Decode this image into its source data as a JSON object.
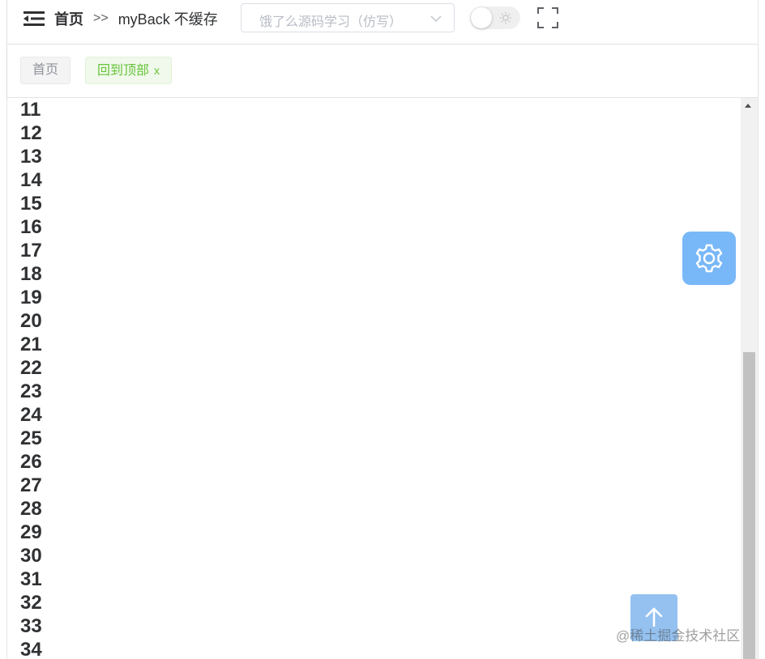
{
  "header": {
    "breadcrumb": {
      "home": "首页",
      "separator": ">>",
      "current": "myBack 不缓存"
    },
    "search_select": {
      "placeholder": "饿了么源码学习（仿写）"
    },
    "theme_switch": {
      "state": "off",
      "icon": "sun-icon"
    },
    "fullscreen_icon": "fullscreen-icon",
    "menu_icon": "menu-fold-icon"
  },
  "tags": [
    {
      "label": "首页",
      "active": false
    },
    {
      "label": "回到顶部",
      "active": true,
      "close": "x"
    }
  ],
  "content": {
    "lines": [
      "11",
      "12",
      "13",
      "14",
      "15",
      "16",
      "17",
      "18",
      "19",
      "20",
      "21",
      "22",
      "23",
      "24",
      "25",
      "26",
      "27",
      "28",
      "29",
      "30",
      "31",
      "32",
      "33",
      "34"
    ]
  },
  "floating": {
    "settings_icon": "gear-icon",
    "backtop_icon": "arrow-up-icon"
  },
  "watermark": "@稀土掘金技术社区",
  "colors": {
    "accent": "#79b8f8",
    "backtop": "#8fbef0",
    "tag_active_bg": "#f0f9eb",
    "tag_active_text": "#67c23a",
    "scroll_thumb": "#c1c1c1"
  }
}
